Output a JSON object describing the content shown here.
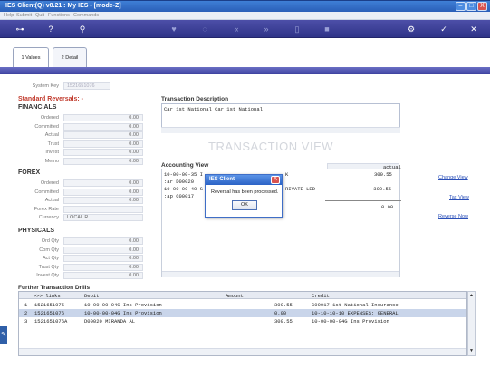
{
  "window": {
    "title": "IES Client(Q) v8.21 : My IES -      [mode-Z]",
    "min": "–",
    "max": "□",
    "close": "X"
  },
  "menu": [
    "Help",
    "Submit",
    "Quit",
    "Functions",
    "Commands"
  ],
  "toolbar": {
    "icons": [
      "key-icon",
      "help-icon",
      "search-icon",
      "heart-icon",
      "circle-icon",
      "rewind-icon",
      "forward-icon",
      "document-icon",
      "stop-icon",
      "settings-icon",
      "check-icon",
      "close-icon"
    ]
  },
  "tabs": [
    {
      "num": "1",
      "label": "Values"
    },
    {
      "num": "2",
      "label": "Detail"
    }
  ],
  "system_key": {
    "label": "System Key",
    "value": "1521651076"
  },
  "left": {
    "standard_reversals": "Standard Reversals: -",
    "financials_title": "FINANCIALS",
    "financials": [
      {
        "label": "Ordered",
        "value": "0.00"
      },
      {
        "label": "Committed",
        "value": "0.00"
      },
      {
        "label": "Actual",
        "value": "0.00"
      },
      {
        "label": "Trust",
        "value": "0.00"
      },
      {
        "label": "Invest",
        "value": "0.00"
      },
      {
        "label": "Memo",
        "value": "0.00"
      }
    ],
    "forex_title": "FOREX",
    "forex": [
      {
        "label": "Ordered",
        "value": "0.00"
      },
      {
        "label": "Committed",
        "value": "0.00"
      },
      {
        "label": "Actual",
        "value": "0.00"
      },
      {
        "label": "Forex Rate",
        "value": ""
      },
      {
        "label": "Currency",
        "value": "LOCAL R"
      }
    ],
    "physicals_title": "PHYSICALS",
    "physicals": [
      {
        "label": "Ord Qty",
        "value": "0.00"
      },
      {
        "label": "Com Qty",
        "value": "0.00"
      },
      {
        "label": "Act Qty",
        "value": "0.00"
      },
      {
        "label": "Trust Qty",
        "value": "0.00"
      },
      {
        "label": "Invest Qty",
        "value": "0.00"
      }
    ]
  },
  "transaction": {
    "desc_title": "Transaction Description",
    "desc_text": "Car 1st National Car 1st National",
    "watermark": "TRANSACTION VIEW",
    "accounting_title": "Accounting View",
    "actual_header": "actual",
    "lines": [
      {
        "left": "10-00-00-35 I",
        "mid": "K",
        "amount": "300.55"
      },
      {
        "left": " :ar  D00020",
        "mid": "",
        "amount": ""
      },
      {
        "left": "10-00-00-40 G",
        "mid": "RIVATE LED",
        "amount": "-300.55"
      },
      {
        "left": " :ap  C00017",
        "mid": "",
        "amount": ""
      }
    ],
    "total": "0.00"
  },
  "side_links": {
    "change_view": "Change View",
    "tax_view": "Tax View",
    "reverse_now": "Reverse Now"
  },
  "dialog": {
    "title": "IES Client",
    "message": "Reversal has been processed.",
    "ok": "OK",
    "close": "X"
  },
  "drills": {
    "title": "Further Transaction Drills",
    "columns": {
      "links": ">>> links",
      "debit": "Debit",
      "amount": "Amount",
      "credit": "Credit"
    },
    "rows": [
      {
        "n": "1",
        "link": "1521651075",
        "debit": "10-00-00-04G Ins Provision",
        "amount": "300.55",
        "credit": "C00017 1st National Insurance"
      },
      {
        "n": "2",
        "link": "1521651076",
        "debit": "10-00-00-04G Ins Provision",
        "amount": "0.00",
        "credit": "10-10-10-10 EXPENSES: GENERAL"
      },
      {
        "n": "3",
        "link": "1521651076A",
        "debit": "D00020 MIRANDA AL",
        "amount": "300.55",
        "credit": "10-00-00-04G Ins Provision"
      }
    ]
  }
}
